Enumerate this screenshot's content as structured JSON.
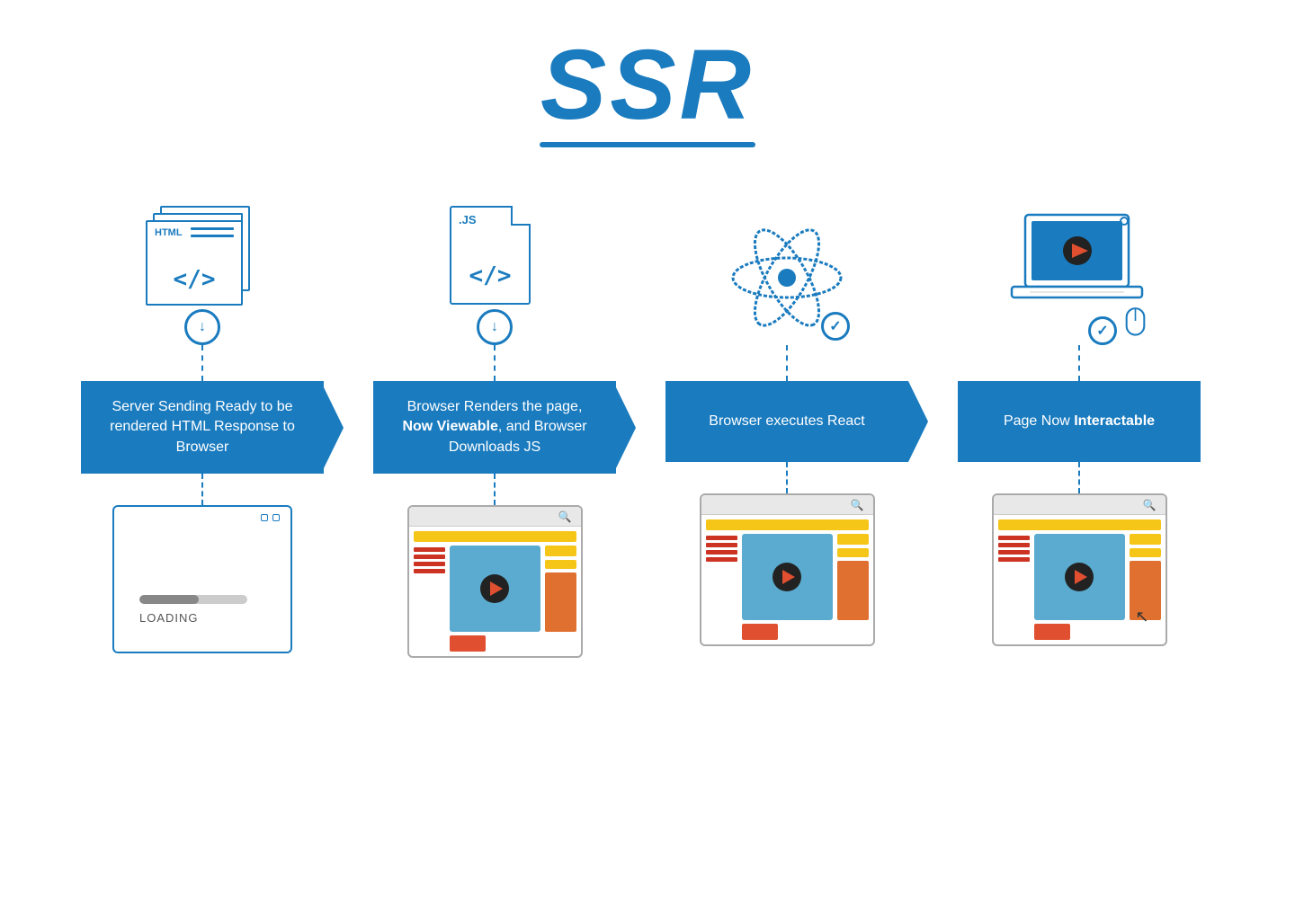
{
  "title": "SSR",
  "steps": [
    {
      "id": "step1",
      "icon_type": "html_stack",
      "box_text": "Server Sending Ready to be rendered HTML Response to Browser",
      "box_bold": [],
      "screen_type": "loading",
      "loading_text": "LOADING"
    },
    {
      "id": "step2",
      "icon_type": "js_file",
      "box_text_parts": [
        "Browser Renders the page, ",
        "Now Viewable",
        ", and Browser Downloads JS"
      ],
      "box_bold": [
        "Now Viewable"
      ],
      "screen_type": "browser_viewable"
    },
    {
      "id": "step3",
      "icon_type": "react_atom",
      "box_text": "Browser executes React",
      "box_bold": [],
      "screen_type": "browser_react"
    },
    {
      "id": "step4",
      "icon_type": "laptop",
      "box_text_parts": [
        "Page Now ",
        "Interactable"
      ],
      "box_bold": [
        "Interactable"
      ],
      "screen_type": "browser_interactable"
    }
  ],
  "colors": {
    "primary": "#1a7bbf",
    "accent_yellow": "#f5c518",
    "accent_red": "#cc3322",
    "accent_orange": "#e07030",
    "accent_blue_light": "#5aabcf"
  }
}
